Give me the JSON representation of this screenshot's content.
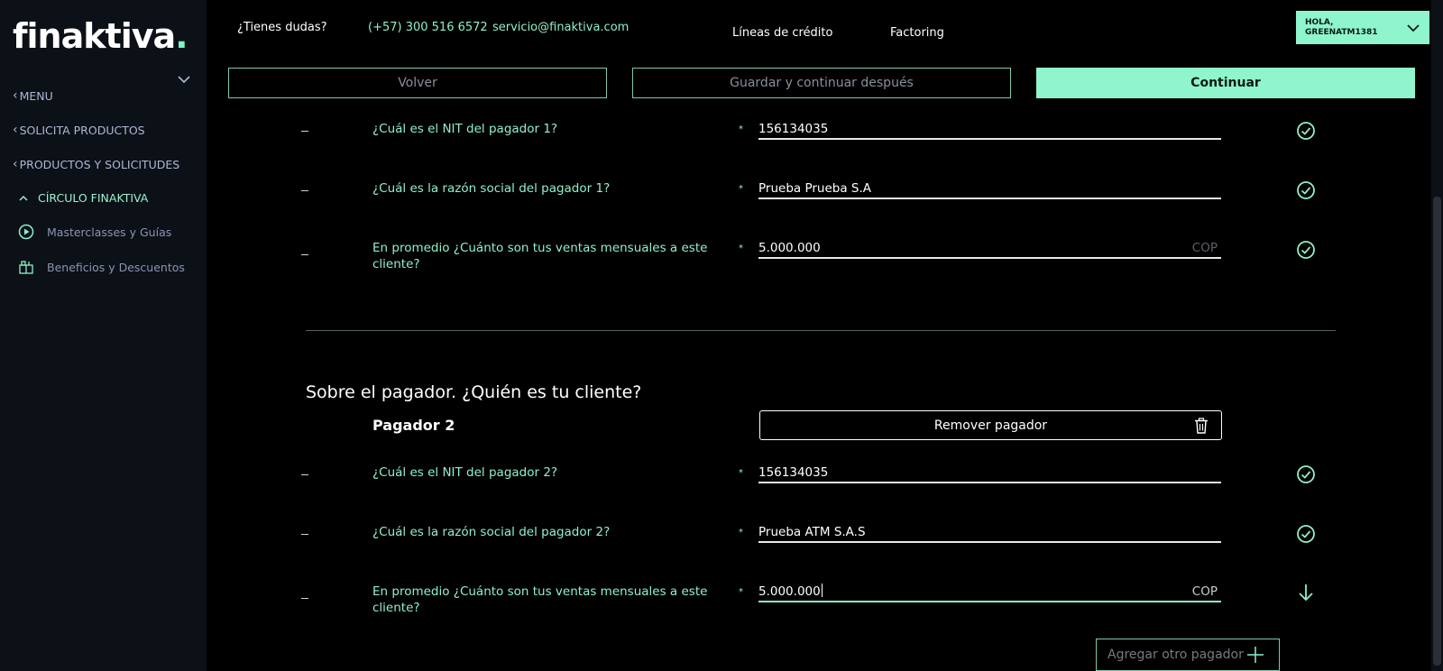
{
  "brand": {
    "logo_text": "finaktiva",
    "logo_dot": ".",
    "accent": "#8ff5cc"
  },
  "sidebar": {
    "items": [
      {
        "label": "MENU"
      },
      {
        "label": "SOLICITA PRODUCTOS"
      },
      {
        "label": "PRODUCTOS Y SOLICITUDES"
      },
      {
        "label": "CÍRCULO FINAKTIVA"
      }
    ],
    "subitems": [
      {
        "label": "Masterclasses y Guías",
        "icon": "play-circle-icon"
      },
      {
        "label": "Beneficios y Descuentos",
        "icon": "gift-store-icon"
      }
    ]
  },
  "header": {
    "help": "¿Tienes dudas?",
    "phone": "(+57) 300 516 6572",
    "email": "servicio@finaktiva.com",
    "nav": [
      "Líneas de crédito",
      "Factoring"
    ],
    "user_greeting": "HOLA,",
    "user_name": "GREENATM1381"
  },
  "actions": {
    "back": "Volver",
    "save_later": "Guardar y continuar después",
    "continue": "Continuar"
  },
  "payer1": {
    "rows": [
      {
        "dash": "-",
        "question": "¿Cuál es el NIT del pagador 1?",
        "value": "156134035",
        "unit": "",
        "status": "check"
      },
      {
        "dash": "-",
        "question": "¿Cuál es la razón social del pagador 1?",
        "value": "Prueba Prueba S.A",
        "unit": "",
        "status": "check"
      },
      {
        "dash": "-",
        "question": "En promedio ¿Cuánto son tus ventas mensuales a este cliente?",
        "value": "5.000.000",
        "unit": "COP",
        "status": "check"
      }
    ]
  },
  "payer2": {
    "section_title": "Sobre el pagador. ¿Quién es tu cliente?",
    "title": "Pagador 2",
    "remove_label": "Remover pagador",
    "rows": [
      {
        "dash": "-",
        "question": "¿Cuál es el NIT del pagador 2?",
        "value": "156134035",
        "unit": "",
        "status": "check"
      },
      {
        "dash": "-",
        "question": "¿Cuál es la razón social del pagador 2?",
        "value": "Prueba ATM S.A.S",
        "unit": "",
        "status": "check"
      },
      {
        "dash": "-",
        "question": "En promedio ¿Cuánto son tus ventas mensuales a este cliente?",
        "value": "5.000.000",
        "unit": "COP",
        "status": "arrow-down"
      }
    ]
  },
  "add_payer": "Agregar otro pagador",
  "required_mark": "*"
}
